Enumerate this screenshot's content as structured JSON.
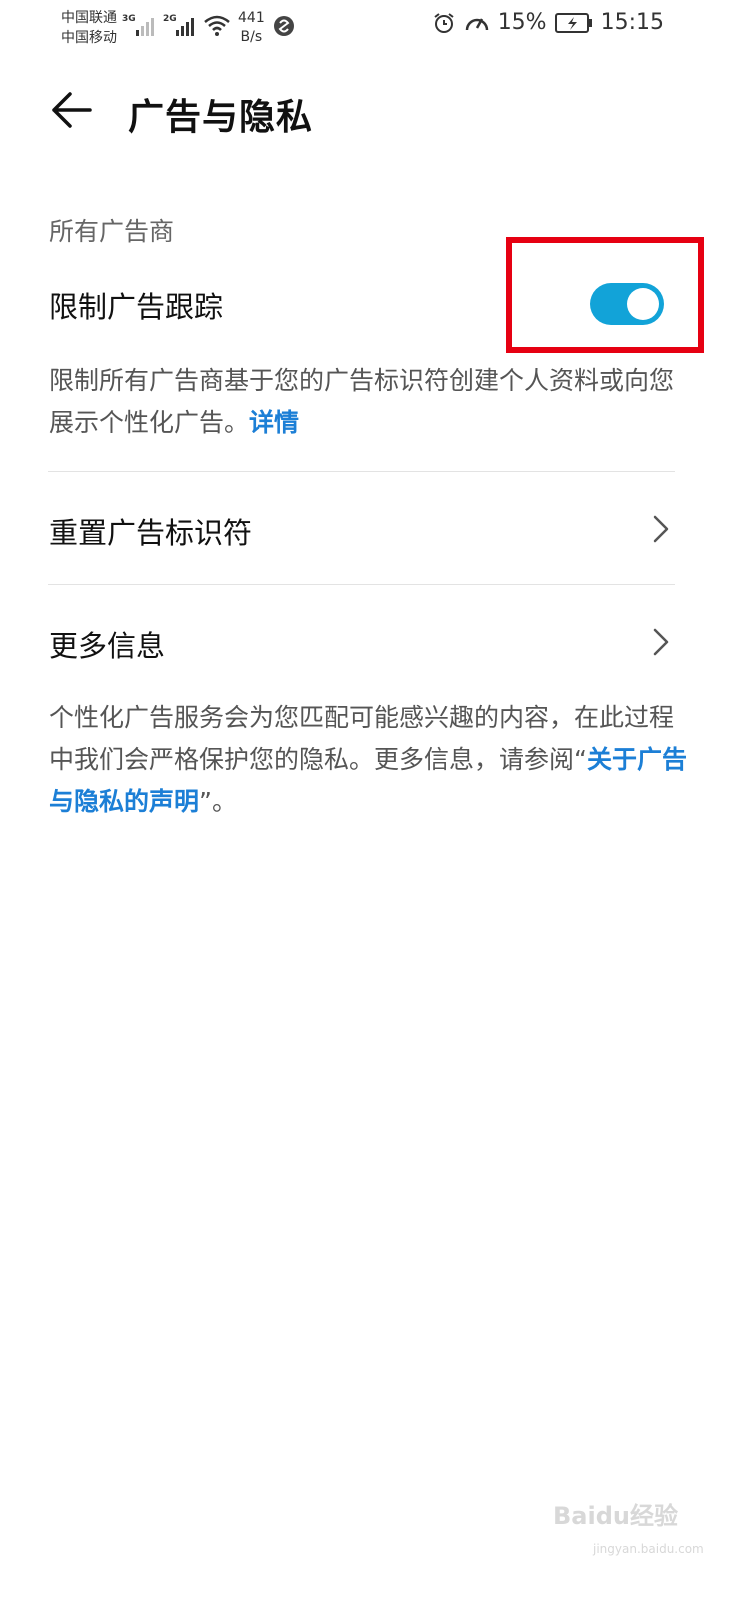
{
  "status_bar": {
    "carrier_1": "中国联通",
    "carrier_2": "中国移动",
    "net_1": "3G",
    "net_2": "2G",
    "speed_value": "441",
    "speed_unit": "B/s",
    "battery": "15%",
    "time": "15:15"
  },
  "header": {
    "title": "广告与隐私"
  },
  "section": {
    "label": "所有广告商"
  },
  "limit_tracking": {
    "label": "限制广告跟踪",
    "enabled": true,
    "description": "限制所有广告商基于您的广告标识符创建个人资料或向您展示个性化广告。",
    "details_link": "详情"
  },
  "reset_row": {
    "label": "重置广告标识符"
  },
  "more_info_row": {
    "label": "更多信息"
  },
  "footer": {
    "text_before": "个性化广告服务会为您匹配可能感兴趣的内容，在此过程中我们会严格保护您的隐私。更多信息，请参阅“",
    "link": "关于广告与隐私的声明",
    "text_after": "”。"
  },
  "watermark": {
    "brand": "Baidu经验",
    "url": "jingyan.baidu.com"
  },
  "colors": {
    "accent": "#12a3d8",
    "link": "#1c7fd6",
    "highlight": "#e60012"
  }
}
